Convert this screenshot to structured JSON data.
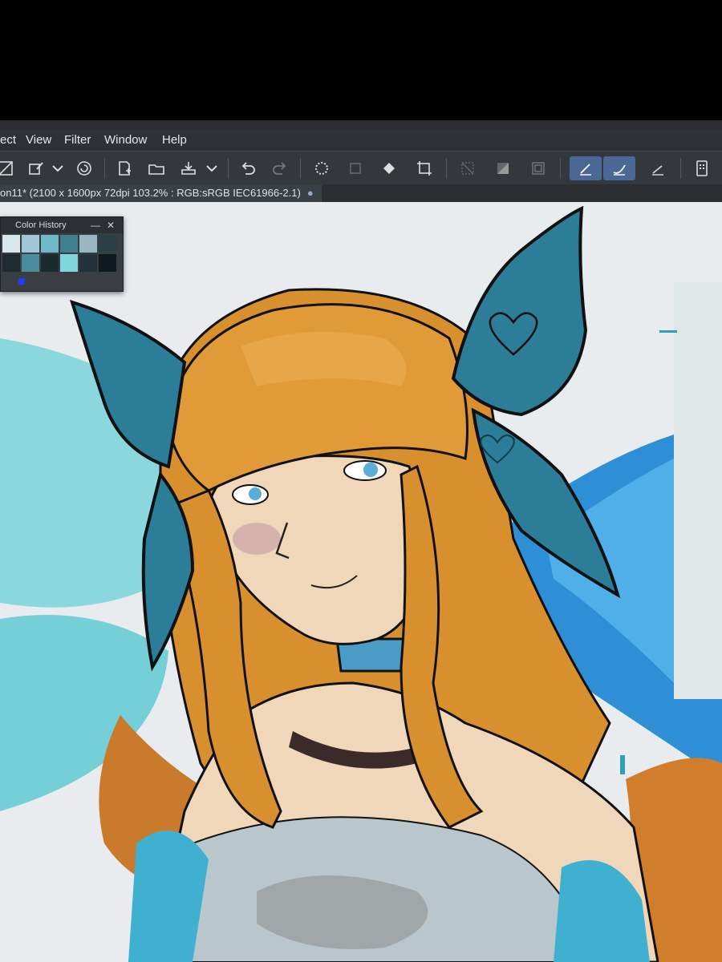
{
  "menu": {
    "items": [
      "ect",
      "View",
      "Filter",
      "Window",
      "Help"
    ]
  },
  "toolbar": {
    "icons": [
      "selection-tool-icon",
      "eyedropper-icon",
      "chevron-down-icon",
      "spiral-icon",
      "new-document-icon",
      "open-folder-icon",
      "save-icon",
      "chevron-down-icon",
      "undo-icon",
      "redo-icon",
      "sparkle-icon",
      "transform-icon",
      "fill-icon",
      "crop-icon",
      "hatch-icon",
      "gradient-icon",
      "frame-icon",
      "pen-icon",
      "brush-icon",
      "ruler-icon",
      "device-icon"
    ]
  },
  "document_tab": {
    "title": "on11* (2100 x 1600px 72dpi 103.2% : RGB:sRGB IEC61966-2.1)",
    "modified_dot": "●"
  },
  "color_history": {
    "title": "Color History",
    "minimize": "—",
    "close": "✕",
    "swatches": [
      "#d8e6ee",
      "#9fc7d6",
      "#6fb8c8",
      "#3f7f8f",
      "#9ab8c4",
      "#2a3f47",
      "#1e2a30",
      "#4a8c9b",
      "#1b2a2f",
      "#7fd6dc",
      "#23323a",
      "#0f1a1e"
    ],
    "current": "#1e3cff"
  },
  "colors": {
    "hair": "#d8902f",
    "wing": "#2c7d97",
    "skin": "#f1d7ba",
    "collar": "#4a9cc5",
    "bg_wings": "#7fd6dc"
  }
}
